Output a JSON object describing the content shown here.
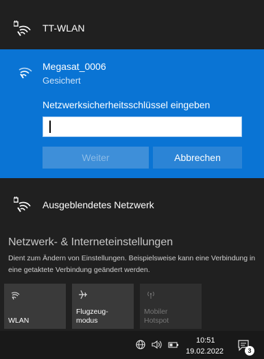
{
  "networks": {
    "top": {
      "name": "TT-WLAN"
    },
    "selected": {
      "name": "Megasat_0006",
      "status": "Gesichert",
      "prompt": "Netzwerksicherheitsschlüssel eingeben",
      "password_value": "",
      "next_label": "Weiter",
      "cancel_label": "Abbrechen"
    },
    "hidden": {
      "name": "Ausgeblendetes Netzwerk"
    }
  },
  "settings": {
    "title": "Netzwerk- & Interneteinstellungen",
    "description": "Dient zum Ändern von Einstellungen. Beispielsweise kann eine Verbindung in eine getaktete Verbindung geändert werden."
  },
  "quick_actions": {
    "wlan": "WLAN",
    "airplane_line1": "Flugzeug-",
    "airplane_line2": "modus",
    "hotspot_line1": "Mobiler",
    "hotspot_line2": "Hotspot"
  },
  "taskbar": {
    "time": "10:51",
    "date": "19.02.2022",
    "notification_count": "3"
  },
  "icons": {
    "wifi": "wifi-secured-icon",
    "airplane": "airplane-icon",
    "hotspot": "hotspot-icon",
    "network_tray": "network-globe-icon",
    "volume": "volume-icon",
    "battery": "battery-icon",
    "notification": "notification-icon"
  },
  "colors": {
    "accent": "#0a74d4",
    "flyout_bg": "#202020",
    "tile_bg": "#3a3a3a"
  }
}
